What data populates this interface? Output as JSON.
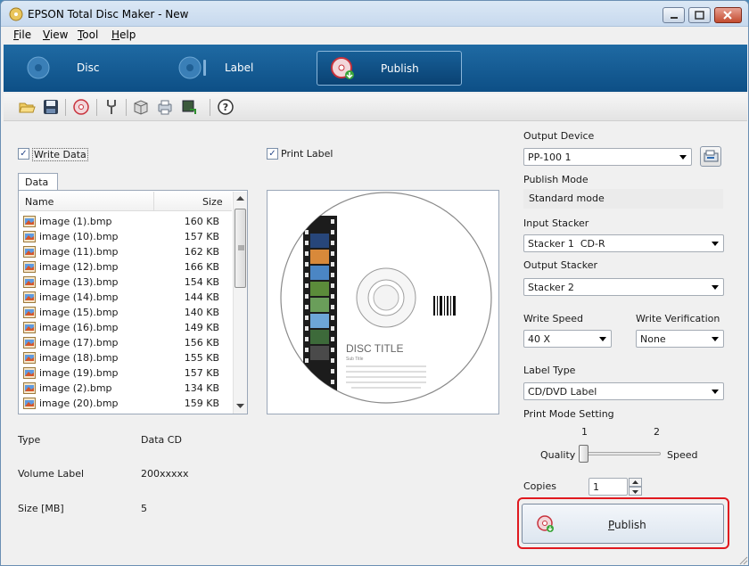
{
  "window": {
    "title": "EPSON Total Disc Maker - New"
  },
  "menu": [
    {
      "label": "File",
      "u": "F",
      "rest": "ile"
    },
    {
      "label": "View",
      "u": "V",
      "rest": "iew"
    },
    {
      "label": "Tool",
      "u": "T",
      "rest": "ool"
    },
    {
      "label": "Help",
      "u": "H",
      "rest": "elp"
    }
  ],
  "modes": [
    {
      "label": "Disc",
      "active": false
    },
    {
      "label": "Label",
      "active": false
    },
    {
      "label": "Publish",
      "active": true
    }
  ],
  "toolbar_icons": [
    "open-folder-icon",
    "save-icon",
    "disc-icon",
    "settings-tool-icon",
    "pack-icon",
    "print-icon",
    "export-icon",
    "help-icon"
  ],
  "write_data": {
    "label": "Write Data",
    "checked": true
  },
  "print_label": {
    "label": "Print Label",
    "checked": true
  },
  "data_tab": "Data",
  "file_list": {
    "columns": [
      "Name",
      "Size"
    ],
    "rows": [
      {
        "name": "image (1).bmp",
        "size": "160 KB"
      },
      {
        "name": "image (10).bmp",
        "size": "157 KB"
      },
      {
        "name": "image (11).bmp",
        "size": "162 KB"
      },
      {
        "name": "image (12).bmp",
        "size": "166 KB"
      },
      {
        "name": "image (13).bmp",
        "size": "154 KB"
      },
      {
        "name": "image (14).bmp",
        "size": "144 KB"
      },
      {
        "name": "image (15).bmp",
        "size": "140 KB"
      },
      {
        "name": "image (16).bmp",
        "size": "149 KB"
      },
      {
        "name": "image (17).bmp",
        "size": "156 KB"
      },
      {
        "name": "image (18).bmp",
        "size": "155 KB"
      },
      {
        "name": "image (19).bmp",
        "size": "157 KB"
      },
      {
        "name": "image (2).bmp",
        "size": "134 KB"
      },
      {
        "name": "image (20).bmp",
        "size": "159 KB"
      }
    ]
  },
  "info": {
    "type_label": "Type",
    "type_value": "Data CD",
    "volume_label": "Volume Label",
    "volume_value": "200xxxxx",
    "size_label": "Size [MB]",
    "size_value": "5"
  },
  "disc_preview": {
    "title": "DISC TITLE",
    "subtitle": "Sub Title"
  },
  "settings": {
    "output_device_label": "Output Device",
    "output_device_value": "PP-100 1",
    "publish_mode_label": "Publish Mode",
    "publish_mode_value": "Standard mode",
    "input_stacker_label": "Input Stacker",
    "input_stacker_value": "Stacker 1  CD-R",
    "output_stacker_label": "Output Stacker",
    "output_stacker_value": "Stacker 2",
    "write_speed_label": "Write Speed",
    "write_speed_value": "40 X",
    "write_verification_label": "Write Verification",
    "write_verification_value": "None",
    "label_type_label": "Label Type",
    "label_type_value": "CD/DVD Label",
    "print_mode_label": "Print Mode Setting",
    "print_mode_tick1": "1",
    "print_mode_tick2": "2",
    "print_mode_left": "Quality",
    "print_mode_right": "Speed",
    "print_mode_level": 1,
    "copies_label": "Copies",
    "copies_value": "1"
  },
  "publish_button": {
    "label": "Publish",
    "u": "P",
    "rest": "ublish"
  },
  "colors": {
    "mode_bar": "#0d4f86",
    "highlight": "#e0191f"
  }
}
